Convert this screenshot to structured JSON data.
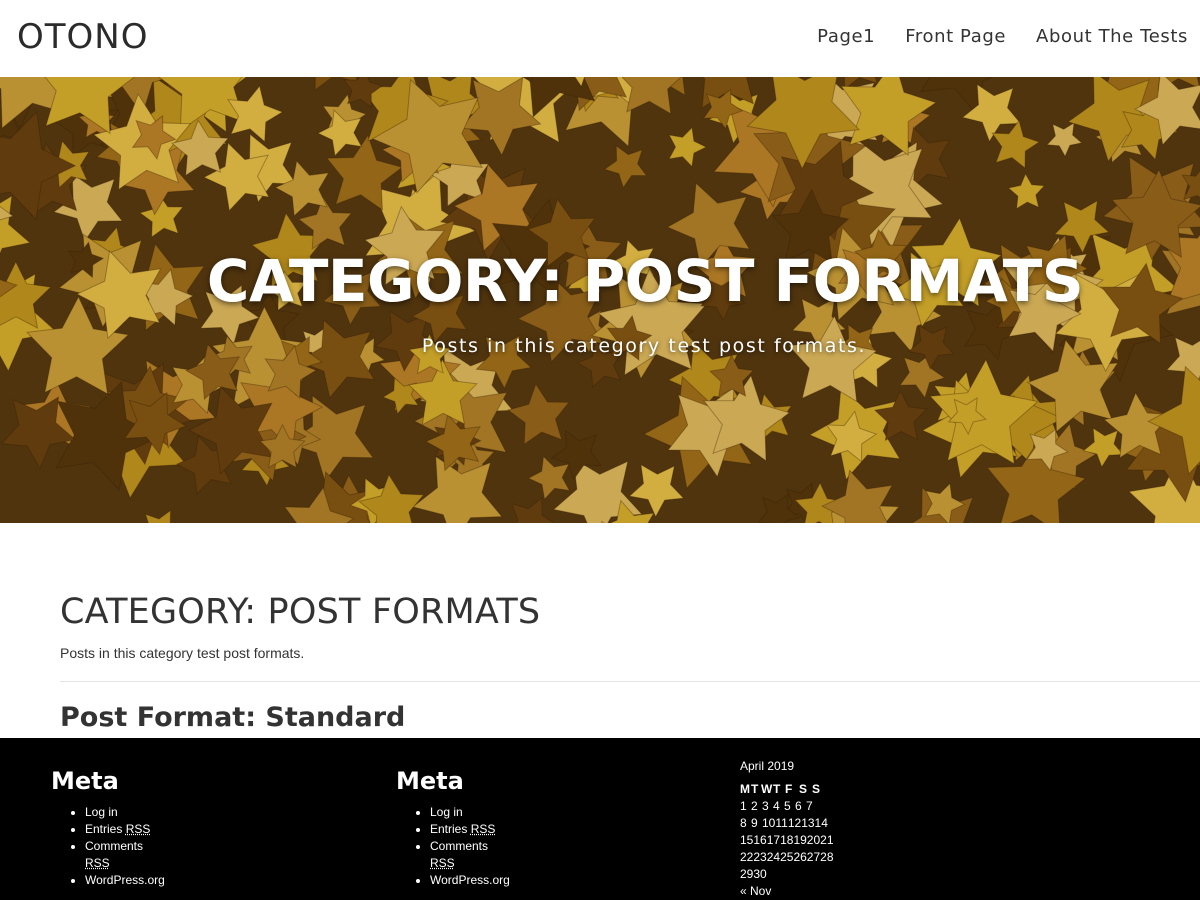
{
  "header": {
    "site_title": "OTONO",
    "nav": [
      "Page1",
      "Front Page",
      "About The Tests"
    ]
  },
  "hero": {
    "title": "CATEGORY: POST FORMATS",
    "description": "Posts in this category test post formats."
  },
  "content": {
    "archive_title": "CATEGORY: POST FORMATS",
    "archive_description": "Posts in this category test post formats.",
    "post_title": "Post Format: Standard"
  },
  "footer": {
    "widgets": [
      {
        "title": "Meta",
        "items": [
          {
            "text": "Log in"
          },
          {
            "text": "Entries ",
            "abbr": "RSS"
          },
          {
            "text": "Comments ",
            "abbr": "RSS"
          },
          {
            "text": "WordPress.org"
          }
        ]
      },
      {
        "title": "Meta",
        "items": [
          {
            "text": "Log in"
          },
          {
            "text": "Entries ",
            "abbr": "RSS"
          },
          {
            "text": "Comments ",
            "abbr": "RSS"
          },
          {
            "text": "WordPress.org"
          }
        ]
      }
    ],
    "calendar": {
      "caption": "April 2019",
      "weekdays": [
        "M",
        "T",
        "W",
        "T",
        "F",
        "S",
        "S"
      ],
      "rows": [
        [
          "1",
          "2",
          "3",
          "4",
          "5",
          "6",
          "7"
        ],
        [
          "8",
          "9",
          "10",
          "11",
          "12",
          "13",
          "14"
        ],
        [
          "15",
          "16",
          "17",
          "18",
          "19",
          "20",
          "21"
        ],
        [
          "22",
          "23",
          "24",
          "25",
          "26",
          "27",
          "28"
        ],
        [
          "29",
          "30"
        ]
      ],
      "prev_link": "« Nov"
    }
  },
  "colors": {
    "footer_bg": "#000000",
    "hero_leaf_base": "#6b4a14",
    "text_dark": "#333333"
  }
}
